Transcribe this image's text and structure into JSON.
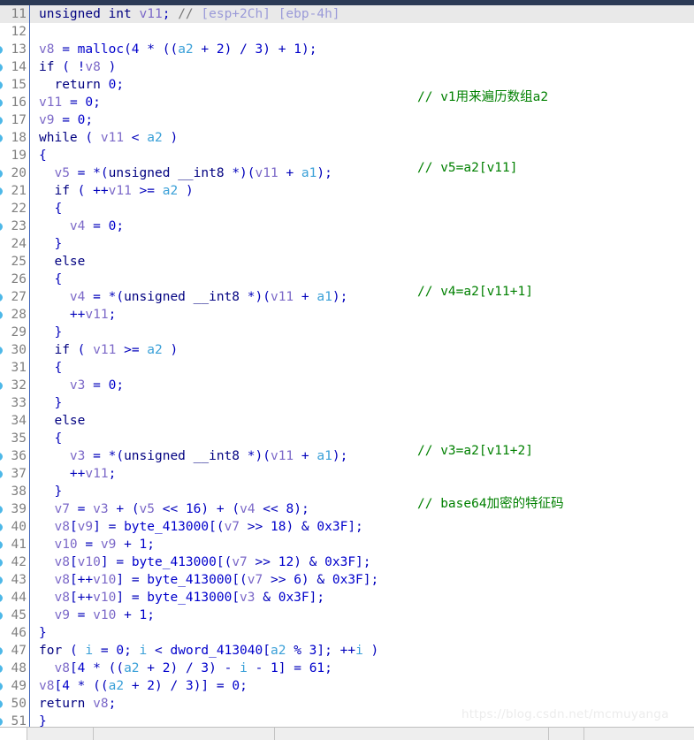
{
  "app": {
    "name": "ida-pseudocode-view",
    "watermark": "https://blog.csdn.net/mcmuyanga"
  },
  "editor": {
    "current_line": 11,
    "first_line": 11,
    "last_line": 51,
    "breakpoint_dot_color": "#4db8e8",
    "current_line_bg": "#e9e9e9",
    "comment_color": "#008000",
    "keyword_color": "#000080",
    "localvar_color": "#7b68c8",
    "argument_color": "#3aa0d8",
    "number_color": "#0000cc"
  },
  "lines": [
    {
      "no": "11",
      "dot": false,
      "current": true,
      "code": "unsigned int v11; // [esp+2Ch] [ebp-4h]"
    },
    {
      "no": "12",
      "dot": false,
      "current": false,
      "code": ""
    },
    {
      "no": "13",
      "dot": true,
      "current": false,
      "code": "v8 = malloc(4 * ((a2 + 2) / 3) + 1);"
    },
    {
      "no": "14",
      "dot": true,
      "current": false,
      "code": "if ( !v8 )"
    },
    {
      "no": "15",
      "dot": true,
      "current": false,
      "code": "  return 0;"
    },
    {
      "no": "16",
      "dot": true,
      "current": false,
      "code": "v11 = 0;"
    },
    {
      "no": "17",
      "dot": true,
      "current": false,
      "code": "v9 = 0;"
    },
    {
      "no": "18",
      "dot": true,
      "current": false,
      "code": "while ( v11 < a2 )"
    },
    {
      "no": "19",
      "dot": false,
      "current": false,
      "code": "{"
    },
    {
      "no": "20",
      "dot": true,
      "current": false,
      "code": "  v5 = *(unsigned __int8 *)(v11 + a1);"
    },
    {
      "no": "21",
      "dot": true,
      "current": false,
      "code": "  if ( ++v11 >= a2 )"
    },
    {
      "no": "22",
      "dot": false,
      "current": false,
      "code": "  {"
    },
    {
      "no": "23",
      "dot": true,
      "current": false,
      "code": "    v4 = 0;"
    },
    {
      "no": "24",
      "dot": false,
      "current": false,
      "code": "  }"
    },
    {
      "no": "25",
      "dot": false,
      "current": false,
      "code": "  else"
    },
    {
      "no": "26",
      "dot": false,
      "current": false,
      "code": "  {"
    },
    {
      "no": "27",
      "dot": true,
      "current": false,
      "code": "    v4 = *(unsigned __int8 *)(v11 + a1);"
    },
    {
      "no": "28",
      "dot": true,
      "current": false,
      "code": "    ++v11;"
    },
    {
      "no": "29",
      "dot": false,
      "current": false,
      "code": "  }"
    },
    {
      "no": "30",
      "dot": true,
      "current": false,
      "code": "  if ( v11 >= a2 )"
    },
    {
      "no": "31",
      "dot": false,
      "current": false,
      "code": "  {"
    },
    {
      "no": "32",
      "dot": true,
      "current": false,
      "code": "    v3 = 0;"
    },
    {
      "no": "33",
      "dot": false,
      "current": false,
      "code": "  }"
    },
    {
      "no": "34",
      "dot": false,
      "current": false,
      "code": "  else"
    },
    {
      "no": "35",
      "dot": false,
      "current": false,
      "code": "  {"
    },
    {
      "no": "36",
      "dot": true,
      "current": false,
      "code": "    v3 = *(unsigned __int8 *)(v11 + a1);"
    },
    {
      "no": "37",
      "dot": true,
      "current": false,
      "code": "    ++v11;"
    },
    {
      "no": "38",
      "dot": false,
      "current": false,
      "code": "  }"
    },
    {
      "no": "39",
      "dot": true,
      "current": false,
      "code": "  v7 = v3 + (v5 << 16) + (v4 << 8);"
    },
    {
      "no": "40",
      "dot": true,
      "current": false,
      "code": "  v8[v9] = byte_413000[(v7 >> 18) & 0x3F];"
    },
    {
      "no": "41",
      "dot": true,
      "current": false,
      "code": "  v10 = v9 + 1;"
    },
    {
      "no": "42",
      "dot": true,
      "current": false,
      "code": "  v8[v10] = byte_413000[(v7 >> 12) & 0x3F];"
    },
    {
      "no": "43",
      "dot": true,
      "current": false,
      "code": "  v8[++v10] = byte_413000[(v7 >> 6) & 0x3F];"
    },
    {
      "no": "44",
      "dot": true,
      "current": false,
      "code": "  v8[++v10] = byte_413000[v3 & 0x3F];"
    },
    {
      "no": "45",
      "dot": true,
      "current": false,
      "code": "  v9 = v10 + 1;"
    },
    {
      "no": "46",
      "dot": false,
      "current": false,
      "code": "}"
    },
    {
      "no": "47",
      "dot": true,
      "current": false,
      "code": "for ( i = 0; i < dword_413040[a2 % 3]; ++i )"
    },
    {
      "no": "48",
      "dot": true,
      "current": false,
      "code": "  v8[4 * ((a2 + 2) / 3) - i - 1] = 61;"
    },
    {
      "no": "49",
      "dot": true,
      "current": false,
      "code": "v8[4 * ((a2 + 2) / 3)] = 0;"
    },
    {
      "no": "50",
      "dot": true,
      "current": false,
      "code": "return v8;"
    },
    {
      "no": "51",
      "dot": true,
      "current": false,
      "code": "}"
    }
  ],
  "user_comments": [
    {
      "line": "16",
      "text": "// v1用来遍历数组a2"
    },
    {
      "line": "20",
      "text": "// v5=a2[v11]"
    },
    {
      "line": "27",
      "text": "// v4=a2[v11+1]"
    },
    {
      "line": "36",
      "text": "// v3=a2[v11+2]"
    },
    {
      "line": "39",
      "text": "// base64加密的特征码"
    }
  ]
}
